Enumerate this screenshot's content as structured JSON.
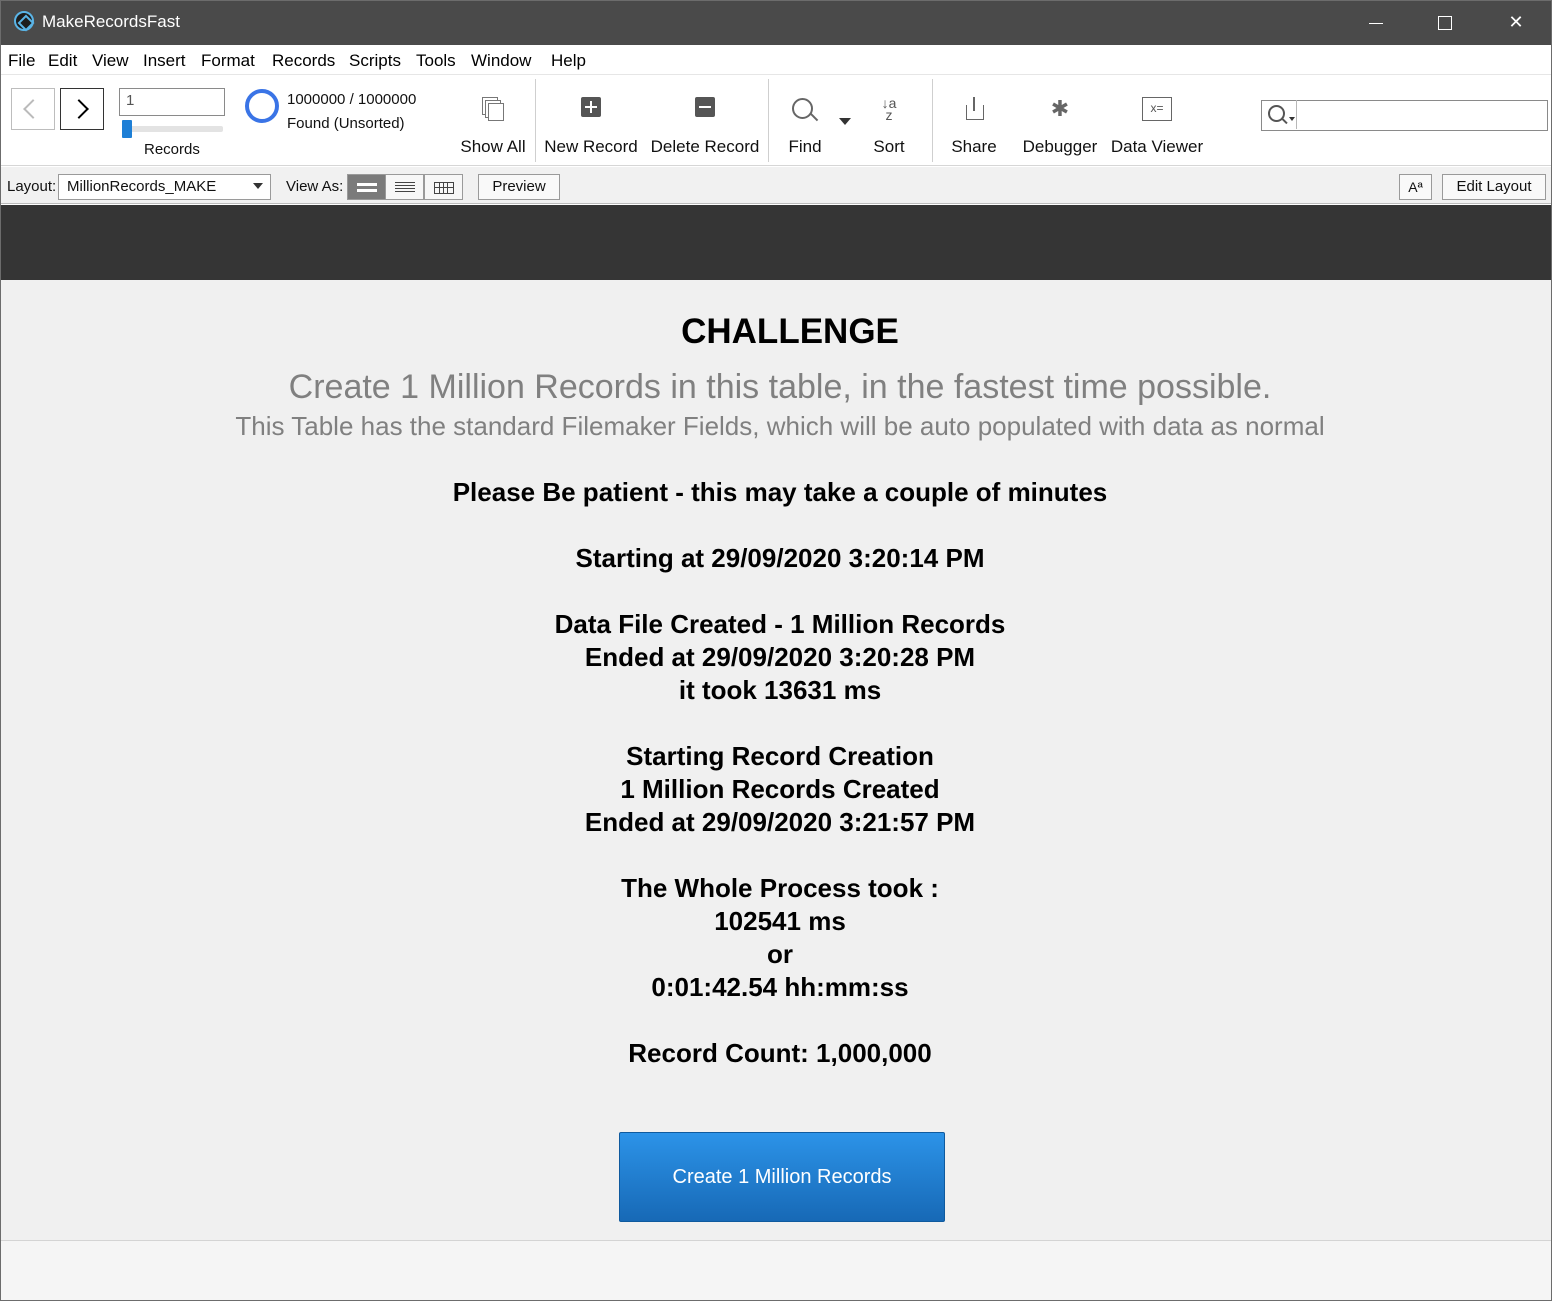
{
  "window": {
    "title": "MakeRecordsFast",
    "controls": {
      "minimize": "",
      "maximize": "",
      "close": "✕"
    }
  },
  "menu": [
    "File",
    "Edit",
    "View",
    "Insert",
    "Format",
    "Records",
    "Scripts",
    "Tools",
    "Window",
    "Help"
  ],
  "toolbar": {
    "record_number": "1",
    "records_label": "Records",
    "found_count": "1000000 / 1000000",
    "found_status": "Found (Unsorted)",
    "show_all": "Show All",
    "new_record": "New Record",
    "delete_record": "Delete Record",
    "find": "Find",
    "sort": "Sort",
    "share": "Share",
    "debugger": "Debugger",
    "data_viewer": "Data Viewer",
    "sort_icon_text": "↓a z",
    "bug_icon_text": "✱",
    "data_viewer_icon_text": "x=",
    "search_value": ""
  },
  "layout_bar": {
    "layout_label": "Layout:",
    "layout_value": "MillionRecords_MAKE",
    "view_as_label": "View As:",
    "preview": "Preview",
    "font_size_button": "Aª",
    "edit_layout": "Edit Layout"
  },
  "content": {
    "title": "CHALLENGE",
    "subtitle": "Create 1 Million Records in this table, in the fastest time possible.",
    "subtitle2": "This Table has the standard Filemaker Fields, which will be auto populated with data as normal",
    "status_lines": [
      "Please Be patient - this may take a couple of minutes",
      "",
      "Starting at 29/09/2020 3:20:14 PM",
      "",
      "Data File Created - 1 Million Records",
      "Ended at 29/09/2020 3:20:28 PM",
      "it took 13631 ms",
      "",
      "Starting Record Creation",
      "1 Million Records Created",
      "Ended at 29/09/2020 3:21:57 PM",
      "",
      "The Whole Process took :",
      "102541 ms",
      "or",
      "0:01:42.54 hh:mm:ss",
      "",
      "Record Count: 1,000,000"
    ],
    "button": "Create 1 Million Records"
  },
  "colors": {
    "title_bar": "#4a4a4a",
    "header_band": "#353535",
    "content_bg": "#f0f0f0",
    "button_top": "#2c93e8",
    "button_bottom": "#1769b6",
    "pie_accent": "#3a74e6"
  }
}
